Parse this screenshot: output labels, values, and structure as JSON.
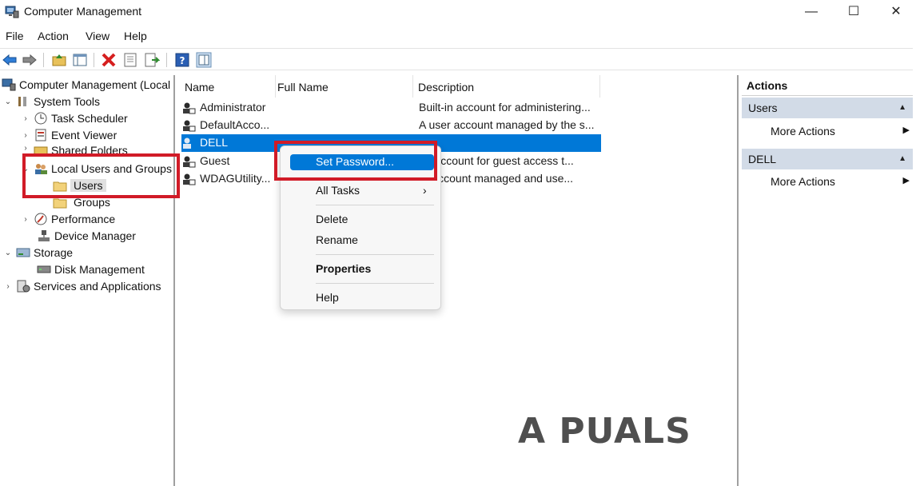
{
  "window": {
    "title": "Computer Management",
    "minimize_glyph": "—",
    "maximize_glyph": "☐",
    "close_glyph": "✕"
  },
  "menu": [
    "File",
    "Action",
    "View",
    "Help"
  ],
  "toolbar": {
    "icons": [
      "back-icon",
      "forward-icon",
      "up-folder-icon",
      "show-hide-tree-icon",
      "delete-icon",
      "properties-icon",
      "export-list-icon",
      "help-icon",
      "show-hide-action-pane-icon"
    ]
  },
  "tree": {
    "root": "Computer Management (Local",
    "system_tools": "System Tools",
    "task_scheduler": "Task Scheduler",
    "event_viewer": "Event Viewer",
    "shared_folders": "Shared Folders",
    "local_users_groups": "Local Users and Groups",
    "users": "Users",
    "groups": "Groups",
    "performance": "Performance",
    "device_manager": "Device Manager",
    "storage": "Storage",
    "disk_management": "Disk Management",
    "services_apps": "Services and Applications"
  },
  "list": {
    "columns": [
      "Name",
      "Full Name",
      "Description"
    ],
    "rows": [
      {
        "name": "Administrator",
        "full_name": "",
        "description": "Built-in account for administering..."
      },
      {
        "name": "DefaultAcco...",
        "full_name": "",
        "description": "A user account managed by the s..."
      },
      {
        "name": "DELL",
        "full_name": "",
        "description": ""
      },
      {
        "name": "Guest",
        "full_name": "",
        "description": "-in account for guest access t..."
      },
      {
        "name": "WDAGUtility...",
        "full_name": "",
        "description": "er account managed and use..."
      }
    ]
  },
  "context_menu": {
    "set_password": "Set Password...",
    "all_tasks": "All Tasks",
    "all_tasks_arrow": "›",
    "delete": "Delete",
    "rename": "Rename",
    "properties": "Properties",
    "help": "Help"
  },
  "actions": {
    "title": "Actions",
    "section1": "Users",
    "section1_more": "More Actions",
    "section2": "DELL",
    "section2_more": "More Actions"
  },
  "watermark": "A PUALS",
  "colors": {
    "selection": "#0078d7",
    "highlight_box": "#d11b27",
    "actions_section": "#d2dbe7"
  }
}
